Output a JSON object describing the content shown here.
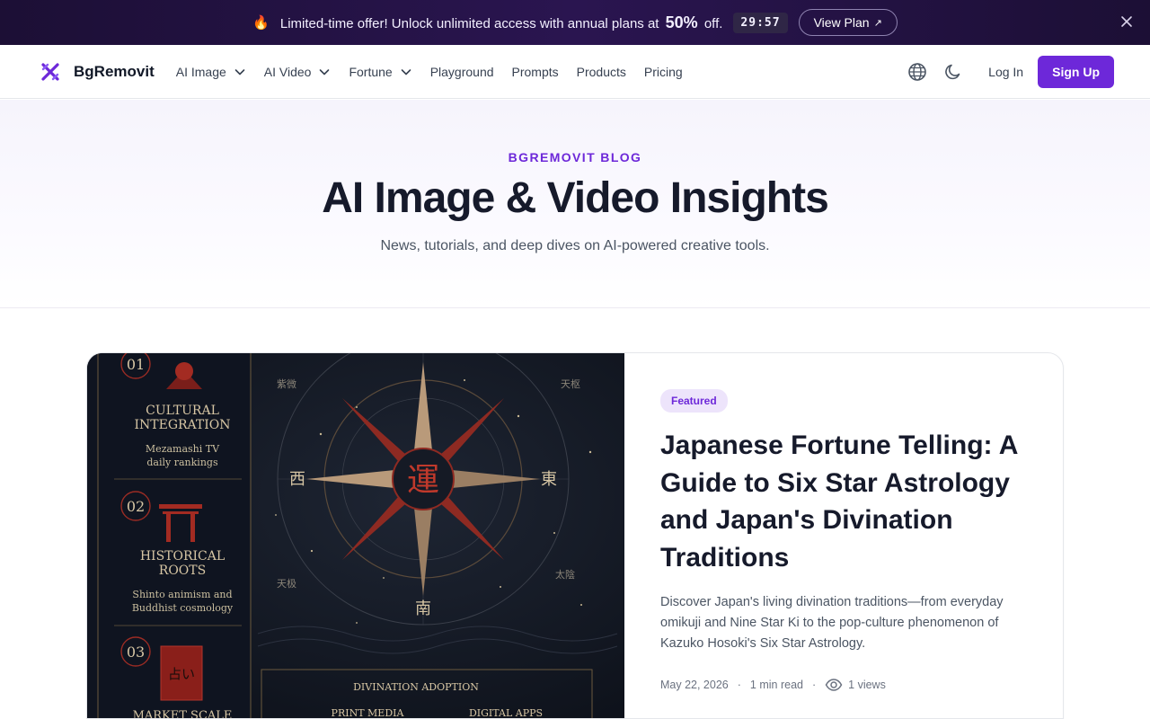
{
  "promo": {
    "message": "Limited-time offer! Unlock unlimited access with annual plans at",
    "discount": "50%",
    "suffix": "off.",
    "timer": "29:57",
    "cta": "View Plan"
  },
  "header": {
    "brand": "BgRemovit",
    "nav": [
      {
        "label": "AI Image",
        "dropdown": true
      },
      {
        "label": "AI Video",
        "dropdown": true
      },
      {
        "label": "Fortune",
        "dropdown": true
      },
      {
        "label": "Playground",
        "dropdown": false
      },
      {
        "label": "Prompts",
        "dropdown": false
      },
      {
        "label": "Products",
        "dropdown": false
      },
      {
        "label": "Pricing",
        "dropdown": false
      }
    ],
    "login": "Log In",
    "signup": "Sign Up"
  },
  "hero": {
    "kicker": "BGREMOVIT BLOG",
    "title": "AI Image & Video Insights",
    "subtitle": "News, tutorials, and deep dives on AI-powered creative tools."
  },
  "featured": {
    "badge": "Featured",
    "title": "Japanese Fortune Telling: A Guide to Six Star Astrology and Japan's Divination Traditions",
    "excerpt": "Discover Japan's living divination traditions—from everyday omikuji and Nine Star Ki to the pop-culture phenomenon of Kazuko Hosoki's Six Star Astrology.",
    "date": "May 22, 2026",
    "read_time": "1 min read",
    "views": "1 views",
    "image": {
      "sections": [
        {
          "num": "01",
          "title1": "CULTURAL",
          "title2": "INTEGRATION",
          "line1": "Mezamashi TV",
          "line2": "daily rankings"
        },
        {
          "num": "02",
          "title1": "HISTORICAL",
          "title2": "ROOTS",
          "line1": "Shinto animism and",
          "line2": "Buddhist cosmology"
        },
        {
          "num": "03",
          "title1": "MARKET SCALE",
          "title2": "",
          "line1": "",
          "line2": ""
        }
      ],
      "compass_center": "運",
      "west": "西",
      "east": "東",
      "south": "南",
      "north_corner_left": "紫微",
      "north_corner_right": "天枢",
      "south_corner_left": "天极",
      "south_corner_right": "太陰",
      "book_glyph": "占い",
      "panel_title": "DIVINATION ADOPTION",
      "panel_left": "PRINT MEDIA",
      "panel_right": "DIGITAL APPS"
    },
    "colors": {
      "accent": "#6d28d9",
      "badge_bg": "#ede4fb"
    }
  }
}
